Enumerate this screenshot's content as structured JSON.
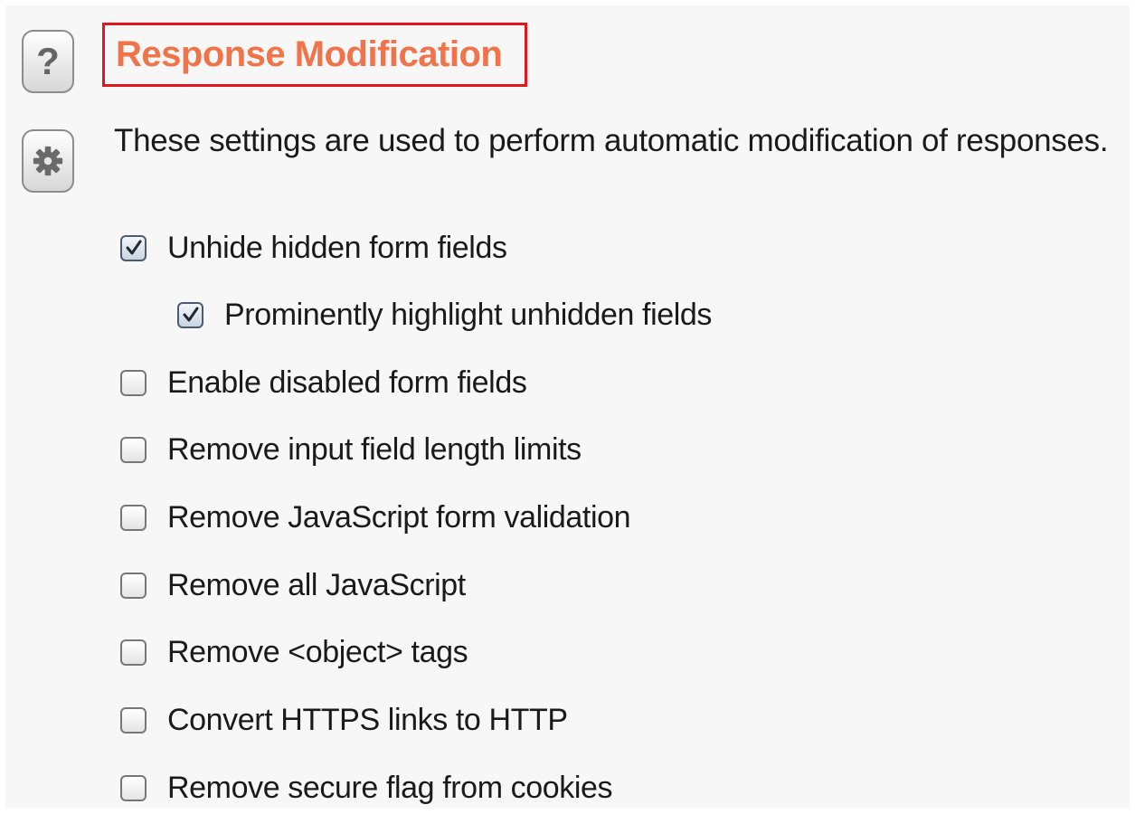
{
  "section": {
    "title": "Response Modification",
    "description": "These settings are used to perform automatic modification of responses."
  },
  "icons": {
    "help": "question-mark-icon",
    "settings": "gear-icon",
    "help_glyph": "?"
  },
  "options": [
    {
      "label": "Unhide hidden form fields",
      "checked": true
    },
    {
      "label": "Prominently highlight unhidden fields",
      "checked": true
    },
    {
      "label": "Enable disabled form fields",
      "checked": false
    },
    {
      "label": "Remove input field length limits",
      "checked": false
    },
    {
      "label": "Remove JavaScript form validation",
      "checked": false
    },
    {
      "label": "Remove all JavaScript",
      "checked": false
    },
    {
      "label": "Remove <object> tags",
      "checked": false
    },
    {
      "label": "Convert HTTPS links to HTTP",
      "checked": false
    },
    {
      "label": "Remove secure flag from cookies",
      "checked": false
    }
  ],
  "colors": {
    "heading": "#f0734a",
    "highlight_border": "#e3161e",
    "panel_background": "#f7f7f7"
  }
}
